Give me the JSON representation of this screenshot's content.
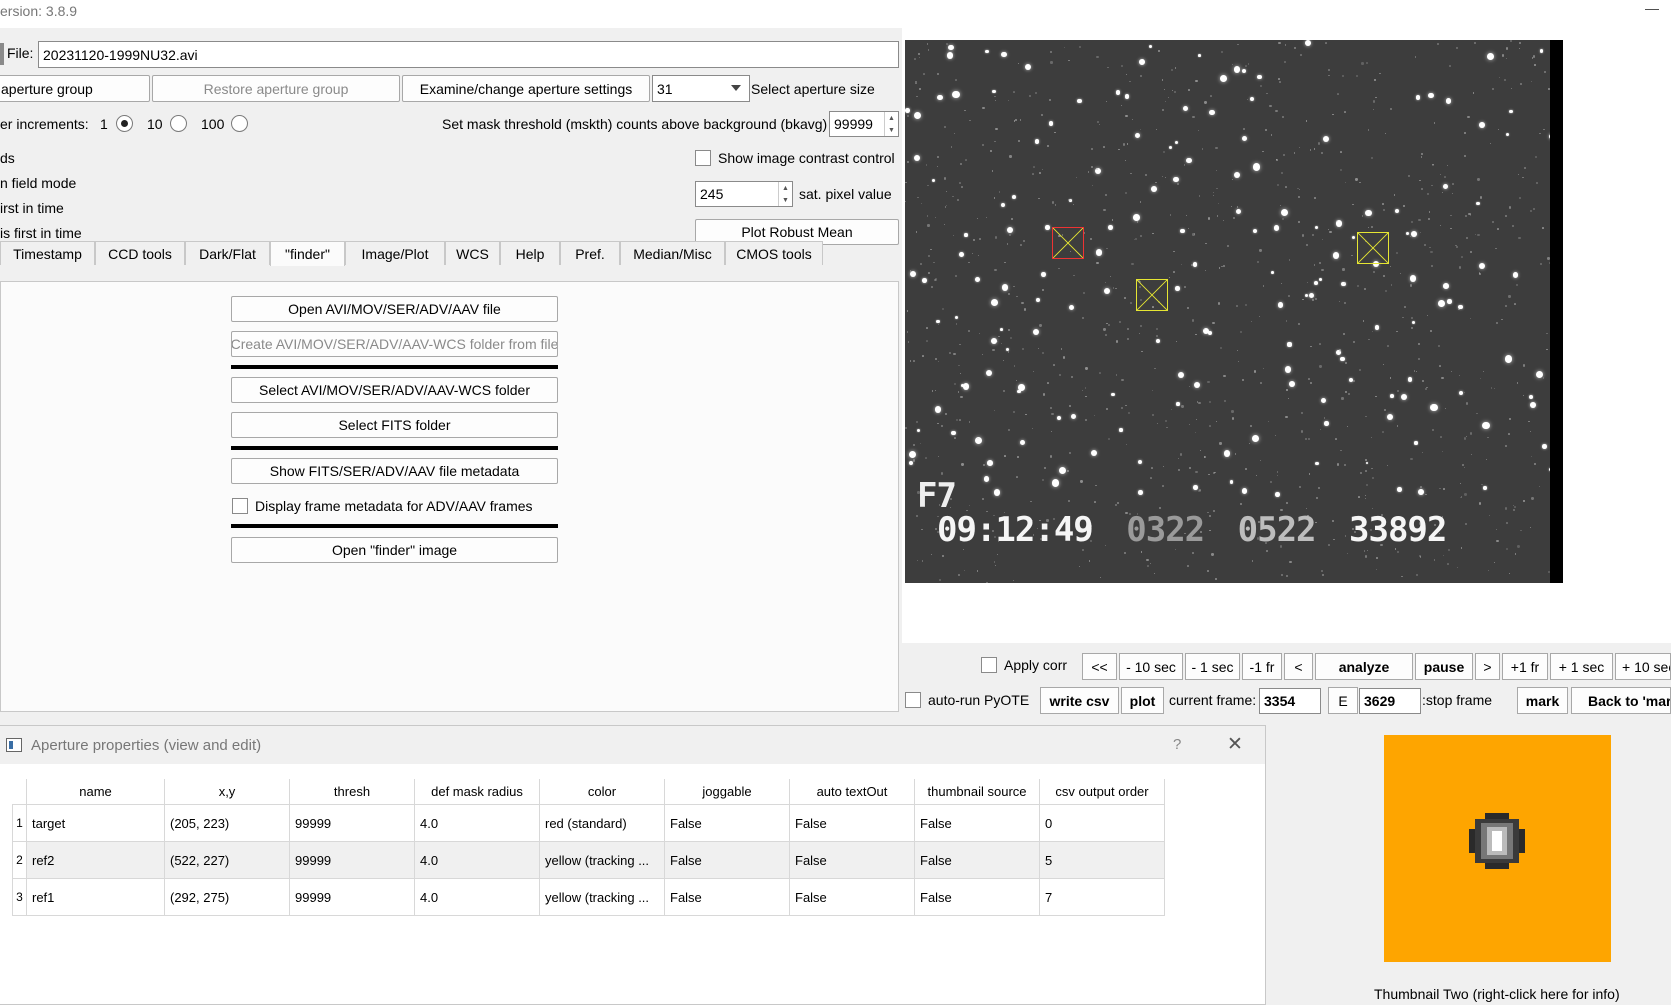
{
  "app": {
    "version_text": "ersion: 3.8.9",
    "minimize_symbol": "—"
  },
  "file": {
    "label": "File:",
    "value": "20231120-1999NU32.avi"
  },
  "aperture_row": {
    "save_group": "aperture group",
    "restore_group": "Restore aperture group",
    "examine": "Examine/change aperture settings",
    "size_value": "31",
    "size_label": "Select aperture size"
  },
  "increments": {
    "label": "er increments:",
    "options": [
      "1",
      "10",
      "100"
    ],
    "selected": "1"
  },
  "mask": {
    "label": "Set mask threshold (mskth) counts above background (bkavg)",
    "value": "99999"
  },
  "left_labels": [
    "ds",
    "n field mode",
    "irst in time",
    " is first in time"
  ],
  "contrast": {
    "label": "Show image contrast control"
  },
  "sat": {
    "value": "245",
    "label": "sat. pixel value"
  },
  "robust_mean": "Plot Robust Mean",
  "tabs": [
    "Timestamp",
    "CCD tools",
    "Dark/Flat",
    "\"finder\"",
    "Image/Plot",
    "WCS",
    "Help",
    "Pref.",
    "Median/Misc",
    "CMOS tools"
  ],
  "finder_panel": {
    "open_file": "Open AVI/MOV/SER/ADV/AAV file",
    "create_wcs": "Create AVI/MOV/SER/ADV/AAV-WCS folder from file",
    "select_wcs": "Select AVI/MOV/SER/ADV/AAV-WCS folder",
    "select_fits": "Select FITS folder",
    "show_meta": "Show FITS/SER/ADV/AAV file metadata",
    "display_meta": "Display frame metadata for ADV/AAV frames",
    "open_finder": "Open \"finder\" image"
  },
  "image": {
    "overlay_id": "F7",
    "overlay_time": "09:12:49",
    "overlay_a": "0322",
    "overlay_b": "0522",
    "overlay_c": "33892"
  },
  "playback": {
    "apply_corr": "Apply corr",
    "buttons": [
      "<<",
      "- 10 sec",
      "- 1 sec",
      "-1 fr",
      "<",
      "analyze",
      "pause",
      ">",
      "+1 fr",
      "+ 1 sec",
      "+ 10 sec"
    ],
    "auto_run": "auto-run PyOTE",
    "write_csv": "write csv",
    "plot": "plot",
    "current_frame_label": "current frame:",
    "current_frame": "3354",
    "e_label": "E",
    "stop_frame": "3629",
    "stop_frame_label": ":stop frame",
    "mark": "mark",
    "back_to": "Back to 'mar"
  },
  "aperture_dialog": {
    "title": "Aperture properties (view and edit)",
    "help_btn": "?",
    "close_btn": "✕",
    "columns": [
      "name",
      "x,y",
      "thresh",
      "def mask radius",
      "color",
      "joggable",
      "auto textOut",
      "thumbnail source",
      "csv output order"
    ],
    "rows": [
      {
        "num": "1",
        "cells": [
          "target",
          "(205, 223)",
          "99999",
          "4.0",
          "red (standard)",
          "False",
          "False",
          "False",
          "0"
        ]
      },
      {
        "num": "2",
        "cells": [
          "ref2",
          "(522, 227)",
          "99999",
          "4.0",
          "yellow (tracking ...",
          "False",
          "False",
          "False",
          "5"
        ]
      },
      {
        "num": "3",
        "cells": [
          "ref1",
          "(292, 275)",
          "99999",
          "4.0",
          "yellow (tracking ...",
          "False",
          "False",
          "False",
          "7"
        ]
      }
    ]
  },
  "thumbnail": {
    "caption": "Thumbnail Two (right-click here for info)",
    "bg_color": "#fea500"
  }
}
